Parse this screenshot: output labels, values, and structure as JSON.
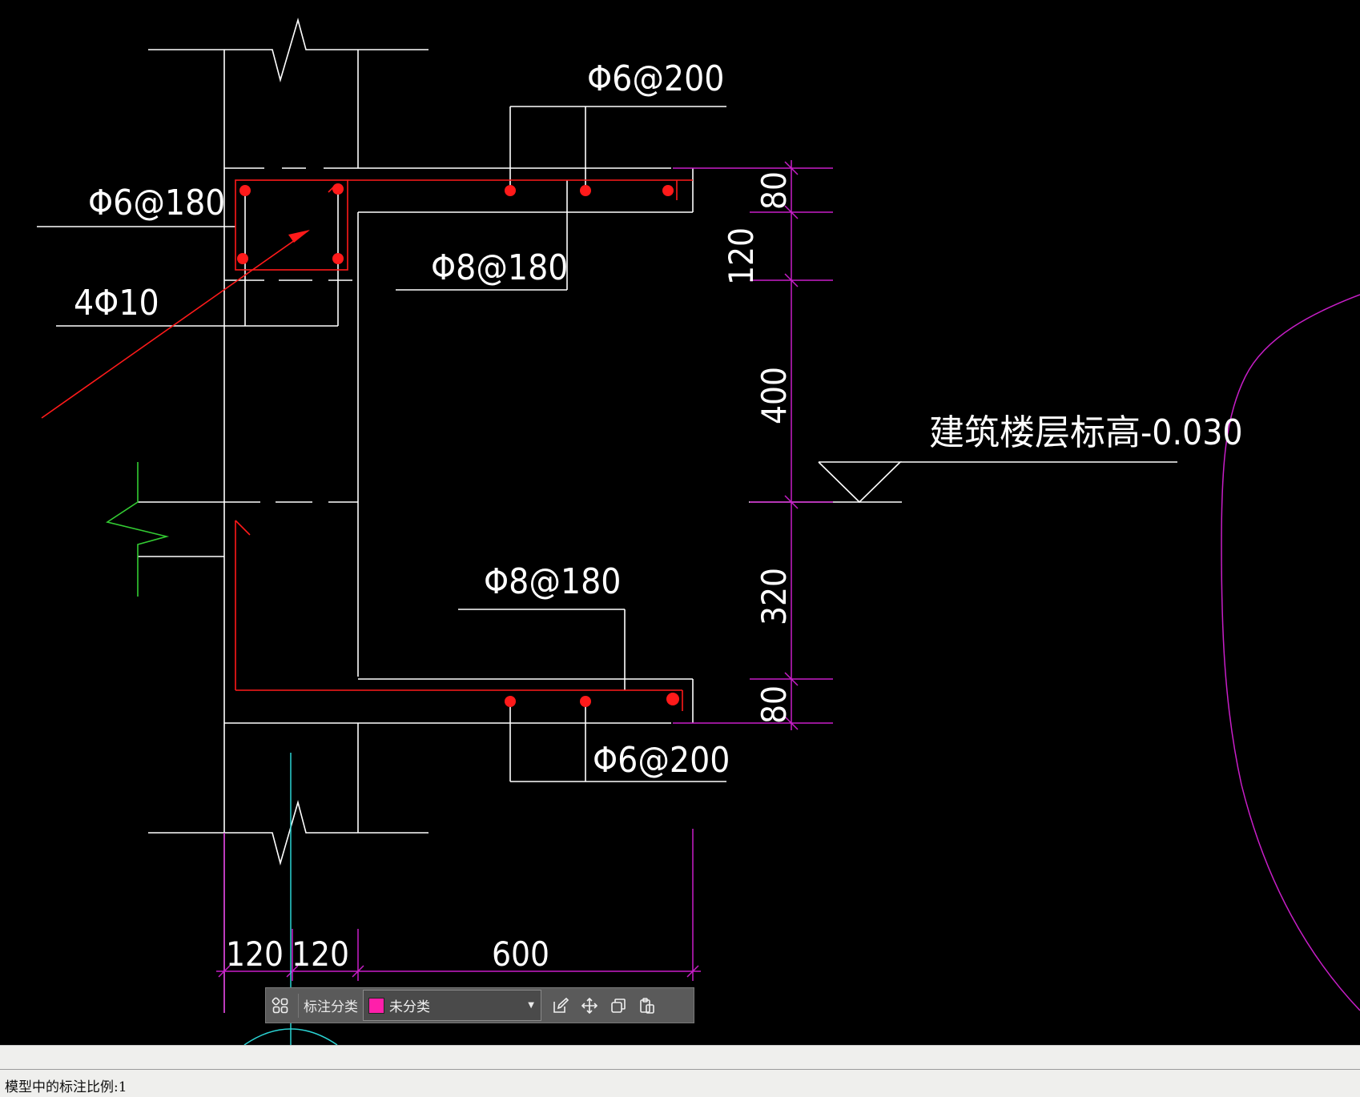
{
  "drawing": {
    "labels": {
      "rebar_top_right": "Φ6@200",
      "rebar_top_left": "Φ6@180",
      "rebar_upper_mid": "Φ8@180",
      "rebar_corner": "4Φ10",
      "rebar_lower_mid": "Φ8@180",
      "rebar_bottom_right": "Φ6@200",
      "floor_elevation": "建筑楼层标高-0.030"
    },
    "dimensions": {
      "vertical": [
        "80",
        "120",
        "400",
        "320",
        "80"
      ],
      "horizontal": [
        "120",
        "120",
        "600"
      ]
    },
    "colors": {
      "background": "#000000",
      "lines": "#ffffff",
      "rebar": "#ff1a1a",
      "dimension": "#c81ec8",
      "marker": "#33cc33",
      "axis": "#2ad3d3"
    }
  },
  "toolbar": {
    "category_label": "标注分类",
    "category_value": "未分类",
    "swatch_color": "#ff1faa",
    "icons": [
      "category-grid-icon",
      "edit-icon",
      "move-icon",
      "copy-icon",
      "paste-icon"
    ]
  },
  "status_bar": {
    "scale_text": "模型中的标注比例:1"
  }
}
